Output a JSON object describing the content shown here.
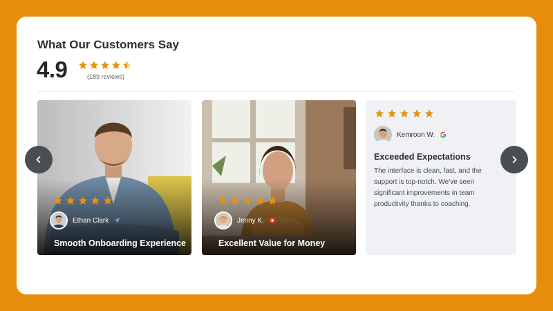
{
  "header": {
    "title": "What Our Customers Say",
    "rating": "4.9",
    "stars": 4.5,
    "reviews_count": "(189 reviews)"
  },
  "colors": {
    "page_background": "#e88d0b",
    "card_background": "#ffffff",
    "star": "#e8920f",
    "nav_button": "#4a4d52"
  },
  "nav": {
    "prev_icon": "chevron-left-icon",
    "next_icon": "chevron-right-icon"
  },
  "reviews": [
    {
      "stars": 5,
      "author": "Ethan Clark",
      "source_icon": "send-icon",
      "title": "Smooth Onboarding Experience",
      "style": "photo"
    },
    {
      "stars": 5,
      "author": "Jenny K.",
      "source_icon": "red-logo-icon",
      "title": "Excellent Value for Money",
      "style": "photo"
    },
    {
      "stars": 5,
      "author": "Kemroon W.",
      "source_icon": "google-icon",
      "title": "Exceeded Expectations",
      "text": "The interface is clean, fast, and the support is top-notch. We've seen significant improvements in team productivity thanks to coaching.",
      "style": "text"
    }
  ]
}
